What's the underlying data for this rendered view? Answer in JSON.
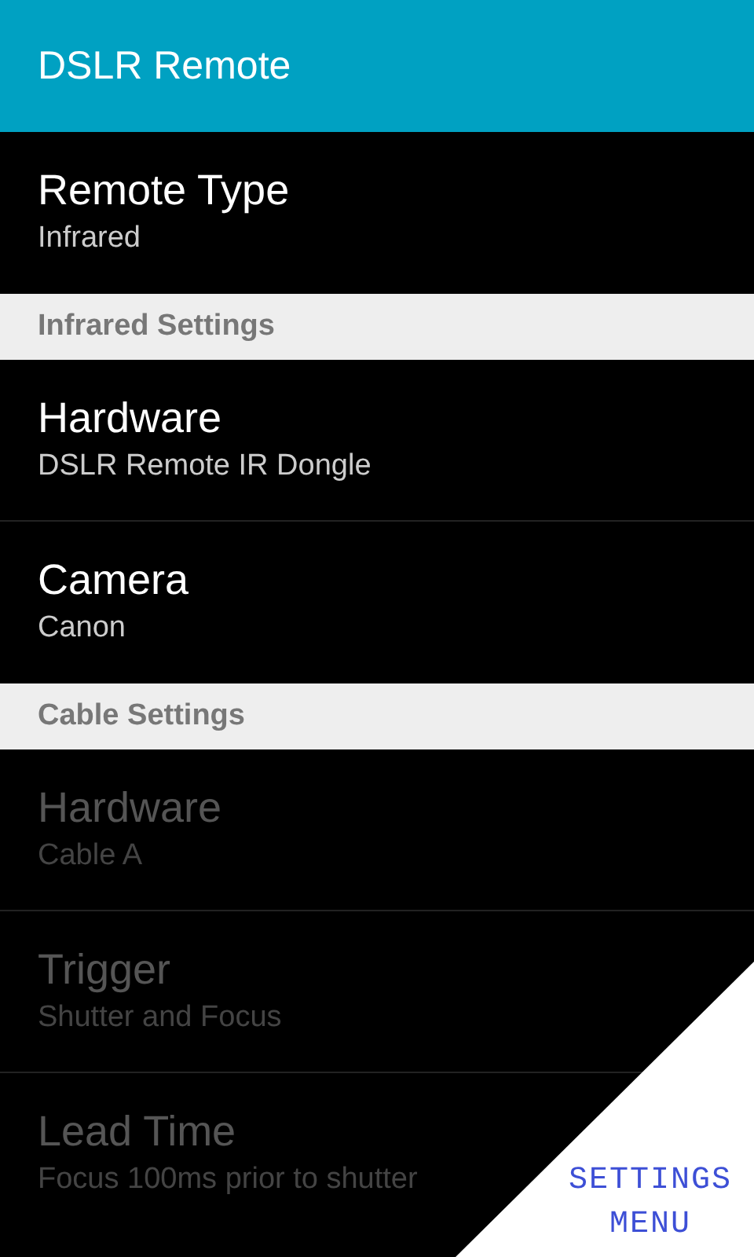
{
  "app_bar": {
    "title": "DSLR Remote"
  },
  "groups": [
    {
      "items": [
        {
          "title": "Remote Type",
          "summary": "Infrared",
          "disabled": false
        }
      ]
    },
    {
      "header": "Infrared Settings",
      "items": [
        {
          "title": "Hardware",
          "summary": "DSLR Remote IR Dongle",
          "disabled": false
        },
        {
          "title": "Camera",
          "summary": "Canon",
          "disabled": false
        }
      ]
    },
    {
      "header": "Cable Settings",
      "items": [
        {
          "title": "Hardware",
          "summary": "Cable A",
          "disabled": true
        },
        {
          "title": "Trigger",
          "summary": "Shutter and Focus",
          "disabled": true
        },
        {
          "title": "Lead Time",
          "summary": "Focus 100ms prior to shutter",
          "disabled": true
        }
      ]
    }
  ],
  "corner_button": {
    "label": "SETTINGS MENU"
  }
}
